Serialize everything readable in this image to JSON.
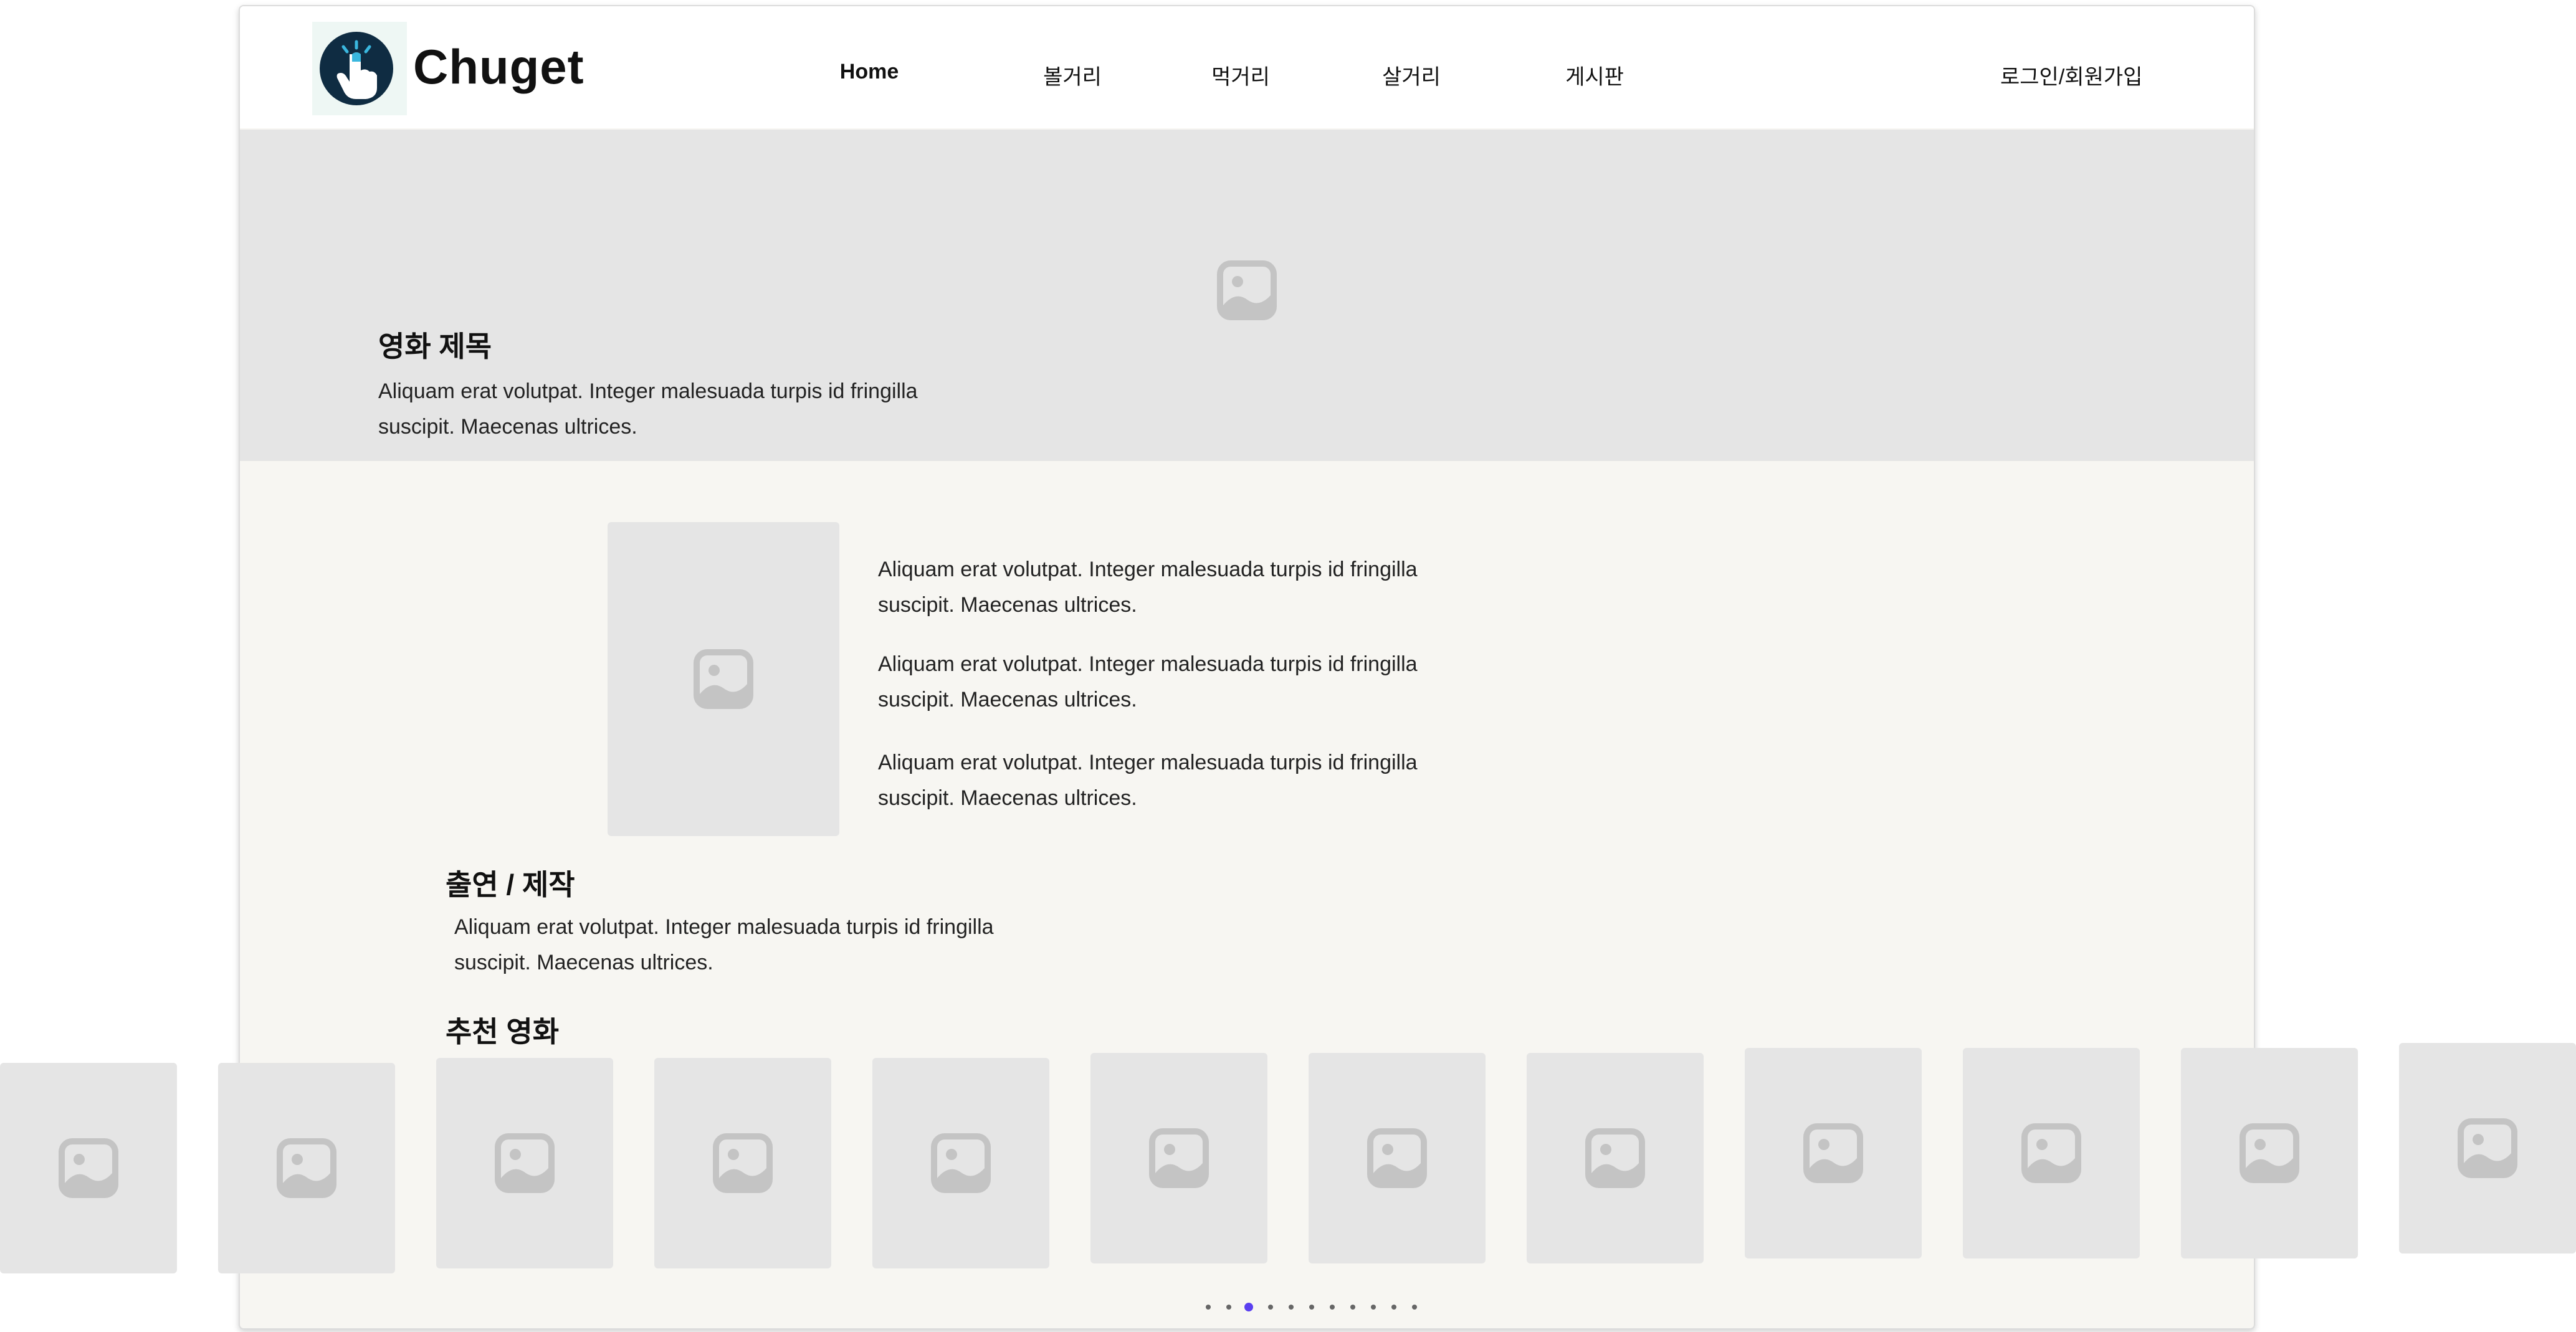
{
  "brand": {
    "name": "Chuget",
    "icon": "pointing-hand-icon"
  },
  "nav": {
    "items": [
      {
        "label": "Home",
        "active": true
      },
      {
        "label": "볼거리"
      },
      {
        "label": "먹거리"
      },
      {
        "label": "살거리"
      },
      {
        "label": "게시판"
      }
    ],
    "auth_label": "로그인/회원가입"
  },
  "hero": {
    "title": "영화 제목",
    "description": "Aliquam erat volutpat. Integer malesuada turpis id fringilla suscipit. Maecenas ultrices.",
    "image_icon": "image-placeholder-icon"
  },
  "details": {
    "poster_icon": "image-placeholder-icon",
    "paragraphs": [
      "Aliquam erat volutpat. Integer malesuada turpis id fringilla suscipit. Maecenas ultrices.",
      "Aliquam erat volutpat. Integer malesuada turpis id fringilla suscipit. Maecenas ultrices.",
      "Aliquam erat volutpat. Integer malesuada turpis id fringilla suscipit. Maecenas ultrices."
    ]
  },
  "credits": {
    "title": "출연 / 제작",
    "description": "Aliquam erat volutpat. Integer malesuada turpis id fringilla suscipit. Maecenas ultrices."
  },
  "recommended": {
    "title": "추천 영화",
    "thumbnail_count": 12,
    "thumbnail_icon": "image-placeholder-icon"
  },
  "carousel": {
    "dot_count": 11,
    "active_index": 2
  },
  "colors": {
    "page_background": "#f7f6f2",
    "placeholder": "#e5e5e5",
    "placeholder_icon": "#c4c4c4",
    "active_dot": "#5a3ff0",
    "logo_circle": "#0f2c42"
  }
}
